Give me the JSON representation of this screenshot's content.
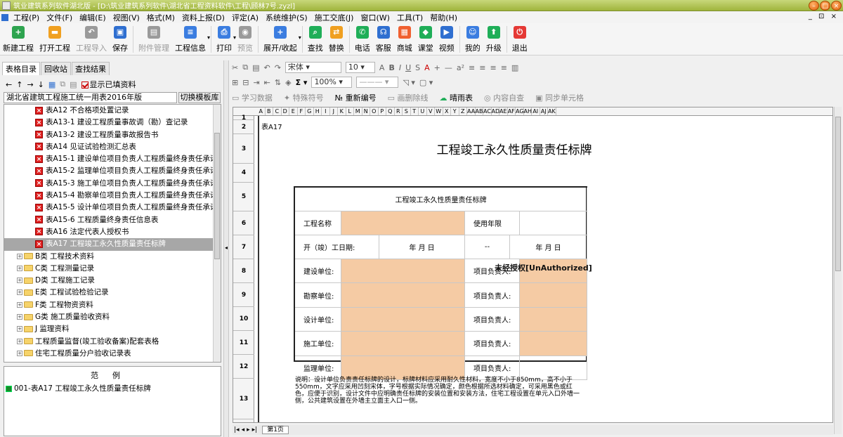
{
  "window": {
    "title": "筑业建筑系列软件湖北版 - [D:\\筑业建筑系列软件\\湖北省工程资料软件\\工程\\顾林7号.zyzl]"
  },
  "menu": [
    "工程(P)",
    "文件(F)",
    "编辑(E)",
    "视图(V)",
    "格式(M)",
    "资料上报(D)",
    "评定(A)",
    "系统维护(S)",
    "施工交底(J)",
    "窗口(W)",
    "工具(T)",
    "帮助(H)"
  ],
  "mdi_controls": "_ ⊡ ×",
  "toolbar": [
    {
      "label": "新建工程",
      "icon": "new-project-icon",
      "color": "#2ea44f",
      "glyph": "+",
      "enabled": true
    },
    {
      "label": "打开工程",
      "icon": "open-project-icon",
      "color": "#f0a020",
      "glyph": "▬",
      "enabled": true
    },
    {
      "label": "工程导入",
      "icon": "import-icon",
      "color": "#9a9a9a",
      "glyph": "↶",
      "enabled": false
    },
    {
      "label": "保存",
      "icon": "save-icon",
      "color": "#2f6fd0",
      "glyph": "▣",
      "enabled": true
    },
    {
      "label": "附件管理",
      "icon": "attachment-icon",
      "color": "#9a9a9a",
      "glyph": "▤",
      "enabled": false
    },
    {
      "label": "工程信息",
      "icon": "project-info-icon",
      "color": "#3b7de0",
      "glyph": "≡",
      "enabled": true,
      "dropdown": true
    },
    {
      "label": "打印",
      "icon": "print-icon",
      "color": "#3b7de0",
      "glyph": "⎙",
      "enabled": true,
      "dropdown": true
    },
    {
      "label": "预览",
      "icon": "preview-icon",
      "color": "#9a9a9a",
      "glyph": "◉",
      "enabled": false
    },
    {
      "label": "展开/收起",
      "icon": "expand-collapse-icon",
      "color": "#3b7de0",
      "glyph": "+",
      "enabled": true,
      "dropdown": true
    },
    {
      "label": "查找",
      "icon": "find-icon",
      "color": "#1fae58",
      "glyph": "⌕",
      "enabled": true
    },
    {
      "label": "替换",
      "icon": "replace-icon",
      "color": "#f0a020",
      "glyph": "⇄",
      "enabled": true
    },
    {
      "label": "电话",
      "icon": "phone-icon",
      "color": "#1fae58",
      "glyph": "✆",
      "enabled": true
    },
    {
      "label": "客服",
      "icon": "support-icon",
      "color": "#2f6fd0",
      "glyph": "☊",
      "enabled": true
    },
    {
      "label": "商城",
      "icon": "shop-icon",
      "color": "#f06030",
      "glyph": "▦",
      "enabled": true
    },
    {
      "label": "课堂",
      "icon": "class-icon",
      "color": "#1fae58",
      "glyph": "◆",
      "enabled": true
    },
    {
      "label": "视频",
      "icon": "video-icon",
      "color": "#2f6fd0",
      "glyph": "▶",
      "enabled": true
    },
    {
      "label": "我的",
      "icon": "user-icon",
      "color": "#3b7de0",
      "glyph": "☺",
      "enabled": true
    },
    {
      "label": "升级",
      "icon": "upgrade-icon",
      "color": "#1fae58",
      "glyph": "⬆",
      "enabled": true
    },
    {
      "label": "退出",
      "icon": "exit-icon",
      "color": "#e53935",
      "glyph": "⏻",
      "enabled": true
    }
  ],
  "left": {
    "tabs": [
      "表格目录",
      "回收站",
      "查找结果"
    ],
    "show_filled_label": "显示已填资料",
    "path": "湖北省建筑工程施工统一用表2016年版",
    "switch_template": "切换模板库",
    "tree": [
      {
        "label": "表A12 不合格项处置记录",
        "type": "doc"
      },
      {
        "label": "表A13-1 建设工程质量事故调（勘）查记录",
        "type": "doc"
      },
      {
        "label": "表A13-2 建设工程质量事故报告书",
        "type": "doc"
      },
      {
        "label": "表A14 见证试验检测汇总表",
        "type": "doc"
      },
      {
        "label": "表A15-1 建设单位项目负责人工程质量终身责任承诺书",
        "type": "doc"
      },
      {
        "label": "表A15-2 监理单位项目负责人工程质量终身责任承诺书",
        "type": "doc"
      },
      {
        "label": "表A15-3 施工单位项目负责人工程质量终身责任承诺书",
        "type": "doc"
      },
      {
        "label": "表A15-4 勘察单位项目负责人工程质量终身责任承诺书",
        "type": "doc"
      },
      {
        "label": "表A15-5 设计单位项目负责人工程质量终身责任承诺书",
        "type": "doc"
      },
      {
        "label": "表A15-6 工程质量终身责任信息表",
        "type": "doc"
      },
      {
        "label": "表A16 法定代表人授权书",
        "type": "doc"
      },
      {
        "label": "表A17 工程竣工永久性质量责任标牌",
        "type": "doc",
        "selected": true
      },
      {
        "label": "B类 工程技术资料",
        "type": "folder"
      },
      {
        "label": "C类 工程测量记录",
        "type": "folder"
      },
      {
        "label": "D类 工程施工记录",
        "type": "folder"
      },
      {
        "label": "E类 工程试验检验记录",
        "type": "folder"
      },
      {
        "label": "F类 工程物资资料",
        "type": "folder"
      },
      {
        "label": "G类 施工质量验收资料",
        "type": "folder"
      },
      {
        "label": "J 监理资料",
        "type": "folder"
      },
      {
        "label": "工程质量监督(竣工验收备案)配套表格",
        "type": "folder"
      },
      {
        "label": "住宅工程质量分户验收记录表",
        "type": "folder"
      }
    ],
    "example_header": "范例",
    "example_item": "001-表A17 工程竣工永久性质量责任标牌"
  },
  "format_toolbar": {
    "font": "宋体",
    "size": "10",
    "zoom": "100%",
    "buttons_row3": [
      "学习数据",
      "特殊符号",
      "重新编号",
      "画删除线",
      "晴雨表",
      "内容自查",
      "同步单元格"
    ]
  },
  "sheet": {
    "columns": [
      "A",
      "B",
      "C",
      "D",
      "E",
      "F",
      "G",
      "H",
      "I",
      "J",
      "K",
      "L",
      "M",
      "N",
      "O",
      "P",
      "Q",
      "R",
      "S",
      "T",
      "U",
      "V",
      "W",
      "X",
      "Y",
      "Z",
      "AA",
      "AB",
      "AC",
      "AD",
      "AE",
      "AF",
      "AG",
      "AH",
      "AI",
      "AJ",
      "AK"
    ],
    "rows": [
      "1",
      "2",
      "3",
      "4",
      "5",
      "6",
      "7",
      "8",
      "9",
      "10",
      "11",
      "12",
      "13"
    ],
    "table_no": "表A17",
    "title": "工程竣工永久性质量责任标牌",
    "form_title": "工程竣工永久性质量责任标牌",
    "project_name_label": "工程名称",
    "service_life_label": "使用年限",
    "start_date_label": "开（竣）工日期:",
    "date_placeholder": "年  月  日",
    "date_sep": "--",
    "units": [
      "建设单位:",
      "勘察单位:",
      "设计单位:",
      "施工单位:",
      "监理单位:"
    ],
    "leader_label": "项目负责人:",
    "watermark": "未经授权[UnAuthorized]",
    "note": "说明：设计单位负责责任标牌的设计，标牌材料应采用耐久性材料，宽度不小于850mm，高不小于550mm，文字应采用凹刻宋体，字号根据实际情况确定，颜色根据所选材料确定，可采用黑色或红色，应便于识别，设计文件中应明确责任标牌的安装位置和安装方法，住宅工程设置在单元入口外墙一侧，公共建筑设置在外墙主立面主入口一侧。",
    "page_tab": "第1页"
  },
  "colors": {
    "fill": "#f5cba4",
    "titlebar": "#a8bb45",
    "selection": "#a7a7a7"
  }
}
